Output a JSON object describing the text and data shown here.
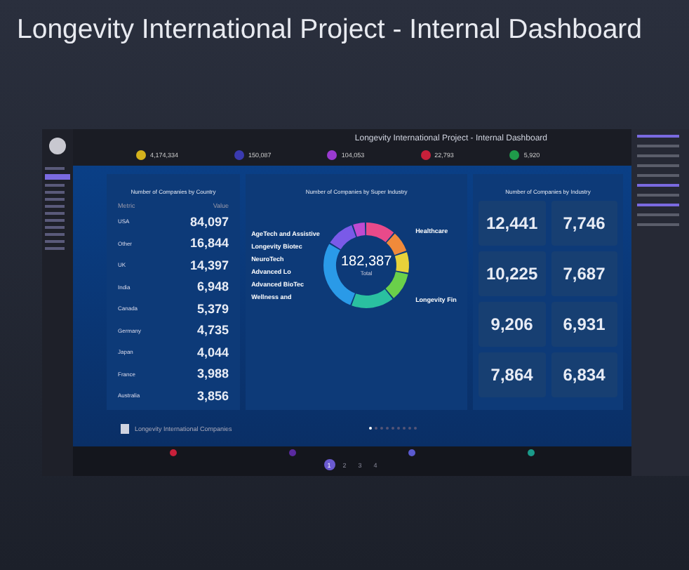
{
  "title": "Longevity International Project - Internal Dashboard",
  "dashboard": {
    "title": "Longevity International Project - Internal Dashboard",
    "stats": [
      {
        "value": "4,174,334",
        "color": "#d4b21c"
      },
      {
        "value": "150,087",
        "color": "#3a3ab0"
      },
      {
        "value": "104,053",
        "color": "#9a3ad0"
      },
      {
        "value": "22,793",
        "color": "#c8203a"
      },
      {
        "value": "5,920",
        "color": "#1f9a4a"
      }
    ],
    "country": {
      "title": "Number of Companies by Country",
      "columns": [
        "Metric",
        "Value"
      ],
      "rows": [
        {
          "name": "USA",
          "value": "84,097"
        },
        {
          "name": "Other",
          "value": "16,844"
        },
        {
          "name": "UK",
          "value": "14,397"
        },
        {
          "name": "India",
          "value": "6,948"
        },
        {
          "name": "Canada",
          "value": "5,379"
        },
        {
          "name": "Germany",
          "value": "4,735"
        },
        {
          "name": "Japan",
          "value": "4,044"
        },
        {
          "name": "France",
          "value": "3,988"
        },
        {
          "name": "Australia",
          "value": "3,856"
        }
      ]
    },
    "super_industry": {
      "title": "Number of Companies by Super Industry",
      "total": "182,387",
      "total_label": "Total",
      "left_labels": [
        "AgeTech and Assistive",
        "Longevity Biotec",
        "NeuroTech",
        "Advanced Lo",
        "Advanced BioTec",
        "Wellness and"
      ],
      "right_labels": [
        "Healthcare",
        "Longevity Fin"
      ]
    },
    "industry": {
      "title": "Number of Companies by Industry",
      "tiles": [
        {
          "value": "12,441"
        },
        {
          "value": "7,746"
        },
        {
          "value": "10,225"
        },
        {
          "value": "7,687"
        },
        {
          "value": "9,206"
        },
        {
          "value": "6,931"
        },
        {
          "value": "7,864"
        },
        {
          "value": "6,834"
        }
      ]
    },
    "footer": "Longevity International Companies",
    "carousel": [
      {
        "selected": true
      },
      {
        "selected": false
      },
      {
        "selected": false
      },
      {
        "selected": false
      },
      {
        "selected": false
      },
      {
        "selected": false
      },
      {
        "selected": false
      },
      {
        "selected": false
      },
      {
        "selected": false
      }
    ],
    "bottom_stats": [
      {
        "color": "#c8203a"
      },
      {
        "color": "#5a2aa0"
      },
      {
        "color": "#5a5ad0"
      },
      {
        "color": "#1a9a8a"
      }
    ],
    "pages": [
      {
        "label": "1",
        "selected": true
      },
      {
        "label": "2",
        "selected": false
      },
      {
        "label": "3",
        "selected": false
      },
      {
        "label": "4",
        "selected": false
      }
    ]
  }
}
